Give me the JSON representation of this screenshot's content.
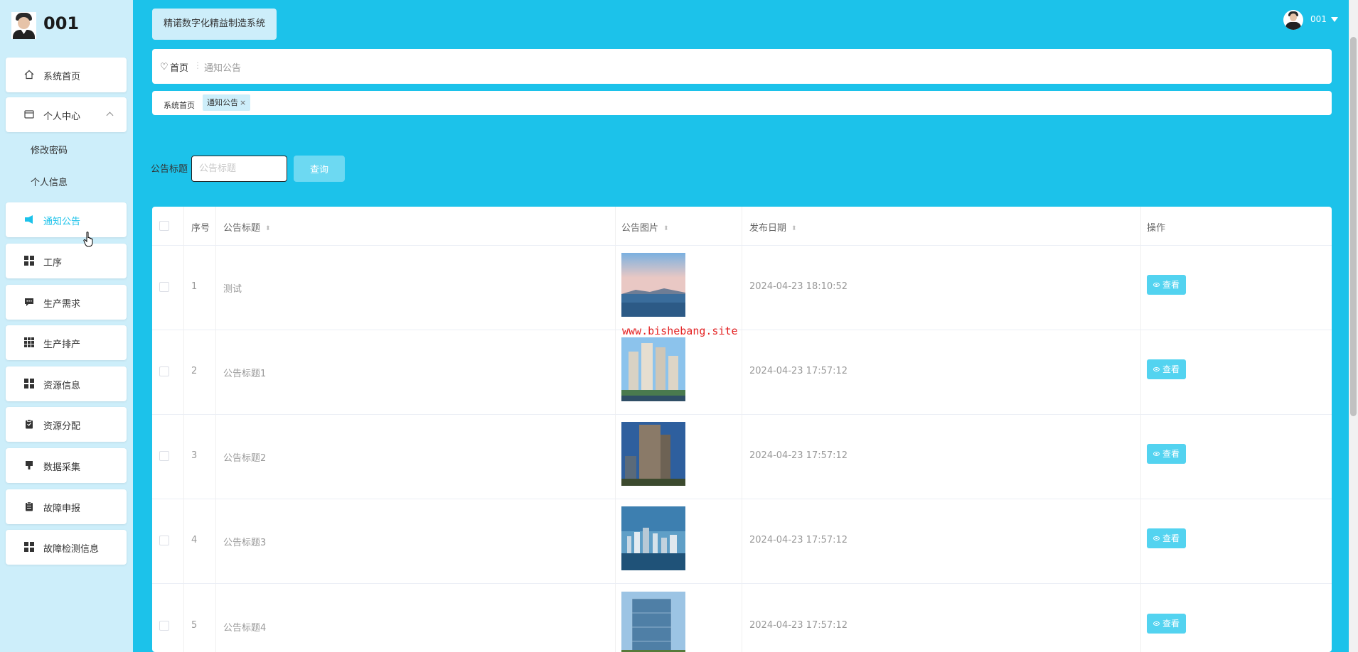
{
  "sidebar": {
    "brand": "001",
    "items": [
      {
        "label": "系统首页",
        "icon": "home-icon"
      },
      {
        "label": "个人中心",
        "icon": "profile-card-icon"
      },
      {
        "label": "修改密码"
      },
      {
        "label": "个人信息"
      },
      {
        "label": "通知公告",
        "icon": "announcement-icon",
        "active": true
      },
      {
        "label": "工序",
        "icon": "grid-icon"
      },
      {
        "label": "生产需求",
        "icon": "comment-icon"
      },
      {
        "label": "生产排产",
        "icon": "grid-9-icon"
      },
      {
        "label": "资源信息",
        "icon": "grid-icon"
      },
      {
        "label": "资源分配",
        "icon": "clipboard-icon"
      },
      {
        "label": "数据采集",
        "icon": "data-icon"
      },
      {
        "label": "故障申报",
        "icon": "clipboard-icon"
      },
      {
        "label": "故障检测信息",
        "icon": "grid-icon"
      }
    ]
  },
  "header": {
    "system_title": "精诺数字化精益制造系统",
    "user_name": "001"
  },
  "breadcrumb": {
    "home": "首页",
    "separator": "⋮",
    "current": "通知公告"
  },
  "tags": {
    "home": "系统首页",
    "active": "通知公告",
    "close": "×"
  },
  "search": {
    "label": "公告标题",
    "placeholder": "公告标题",
    "button": "查询"
  },
  "table": {
    "headers": [
      "序号",
      "公告标题",
      "公告图片",
      "发布日期",
      "操作"
    ],
    "sort_glyph": "⬍",
    "rows": [
      {
        "no": "1",
        "title": "测试",
        "image": "sea-mountain-photo",
        "date": "2024-04-23 18:10:52",
        "action": "查看"
      },
      {
        "no": "2",
        "title": "公告标题1",
        "image": "apartment-towers-photo",
        "date": "2024-04-23 17:57:12",
        "action": "查看"
      },
      {
        "no": "3",
        "title": "公告标题2",
        "image": "tall-tower-photo",
        "date": "2024-04-23 17:57:12",
        "action": "查看"
      },
      {
        "no": "4",
        "title": "公告标题3",
        "image": "city-skyline-photo",
        "date": "2024-04-23 17:57:12",
        "action": "查看"
      },
      {
        "no": "5",
        "title": "公告标题4",
        "image": "glass-building-photo",
        "date": "2024-04-23 17:57:12",
        "action": "查看"
      }
    ]
  },
  "watermark": "www.bishebang.site",
  "colors": {
    "primary": "#1cc2ea",
    "sidebar_bg": "#cdeefa",
    "button": "#53d3f0",
    "watermark": "#e52323"
  }
}
